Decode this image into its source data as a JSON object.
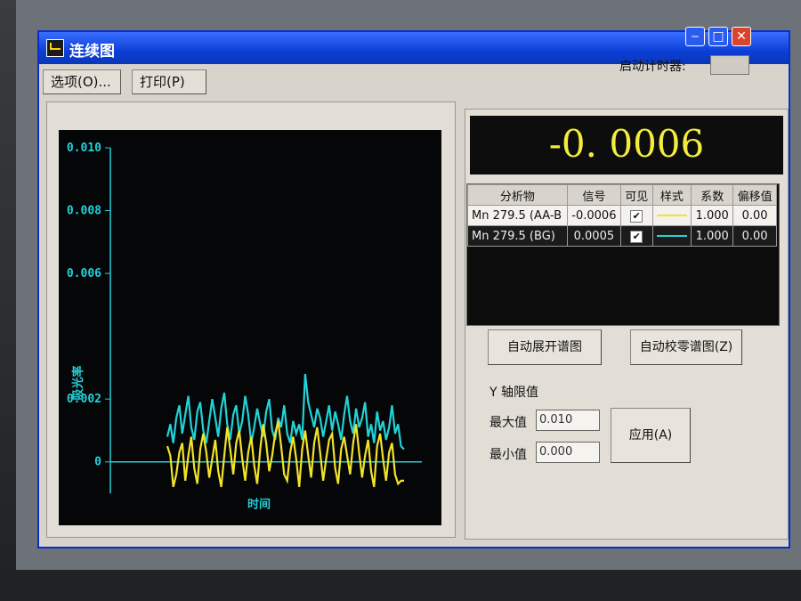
{
  "window": {
    "title": "连续图"
  },
  "toolbar": {
    "options_label": "选项(O)...",
    "print_label": "打印(P)",
    "timer_label": "启动计时器:"
  },
  "display": {
    "value": "-0. 0006"
  },
  "table": {
    "headers": [
      "分析物",
      "信号",
      "可见",
      "样式",
      "系数",
      "偏移值"
    ],
    "rows": [
      {
        "analyte": "Mn 279.5 (AA-B",
        "signal": "-0.0006",
        "visible": true,
        "style_color": "#f1e32a",
        "factor": "1.000",
        "offset": "0.00"
      },
      {
        "analyte": "Mn 279.5 (BG)",
        "signal": "0.0005",
        "visible": true,
        "style_color": "#22d3d6",
        "factor": "1.000",
        "offset": "0.00"
      }
    ]
  },
  "buttons": {
    "auto_expand": "自动展开谱图",
    "auto_zero": "自动校零谱图(Z)",
    "apply": "应用(A)"
  },
  "y_limits": {
    "title": "Y 轴限值",
    "max_label": "最大值",
    "max_value": "0.010",
    "min_label": "最小值",
    "min_value": "0.000"
  },
  "chart_data": {
    "type": "line",
    "ylabel": "吸光率",
    "xlabel": "时间",
    "ylim": [
      -0.001,
      0.01
    ],
    "yticks": [
      "0.010",
      "0.008",
      "0.006",
      "0.002",
      "0"
    ],
    "ytick_values": [
      0.01,
      0.008,
      0.006,
      0.002,
      0
    ],
    "series": [
      {
        "name": "Mn 279.5 (AA-B",
        "color": "#f1e32a",
        "values": [
          0.0005,
          0.0002,
          -0.0008,
          -0.0004,
          0.0003,
          0.0006,
          -0.0006,
          0.0002,
          0.0008,
          -0.0002,
          -0.0007,
          0.0004,
          0.0009,
          0.0003,
          -0.0005,
          0.0001,
          0.0007,
          -0.0003,
          -0.0008,
          0.0002,
          0.0011,
          0.0004,
          -0.0004,
          0.0006,
          0.001,
          0.0001,
          -0.0006,
          0.0003,
          0.0008,
          -0.0001,
          -0.0007,
          0.0004,
          0.0012,
          0.0006,
          -0.0003,
          0.0002,
          0.0009,
          0.0013,
          0.0005,
          -0.0004,
          -0.0006,
          0.0003,
          0.0008,
          0.0001,
          -0.0008,
          0.0004,
          0.001,
          0.0002,
          -0.0005,
          0.0006,
          0.0011,
          0.0003,
          -0.0006,
          0.0001,
          0.0007,
          0.0009,
          -0.0002,
          -0.0007,
          0.0004,
          0.0008,
          0.0002,
          -0.0004,
          0.0006,
          0.0012,
          0.0003,
          -0.0005,
          0.0002,
          0.0007,
          -0.0003,
          -0.0008,
          0.0005,
          0.0009,
          0.0001,
          -0.0006,
          0.0003,
          0.0006,
          -0.0004,
          -0.0007,
          -0.0006,
          -0.0006
        ]
      },
      {
        "name": "Mn 279.5 (BG)",
        "color": "#22d3d6",
        "values": [
          0.0008,
          0.0012,
          0.0006,
          0.0014,
          0.0018,
          0.0009,
          0.0015,
          0.0021,
          0.0011,
          0.0007,
          0.0016,
          0.0019,
          0.001,
          0.0006,
          0.0013,
          0.002,
          0.0014,
          0.0008,
          0.0017,
          0.0022,
          0.0012,
          0.0007,
          0.0015,
          0.0018,
          0.0009,
          0.0013,
          0.0021,
          0.0015,
          0.0006,
          0.0011,
          0.0017,
          0.0012,
          0.0008,
          0.0016,
          0.002,
          0.001,
          0.0007,
          0.0014,
          0.0011,
          0.0018,
          0.0009,
          0.0006,
          0.0013,
          0.0009,
          0.0012,
          0.0007,
          0.0028,
          0.0019,
          0.0015,
          0.0011,
          0.0017,
          0.0014,
          0.0008,
          0.0013,
          0.0018,
          0.001,
          0.0016,
          0.0012,
          0.0007,
          0.0015,
          0.0021,
          0.0013,
          0.0009,
          0.0017,
          0.0011,
          0.0014,
          0.0019,
          0.0008,
          0.0012,
          0.0006,
          0.0016,
          0.001,
          0.0013,
          0.0007,
          0.0011,
          0.0018,
          0.0009,
          0.0012,
          0.0005,
          0.0004
        ]
      }
    ]
  }
}
